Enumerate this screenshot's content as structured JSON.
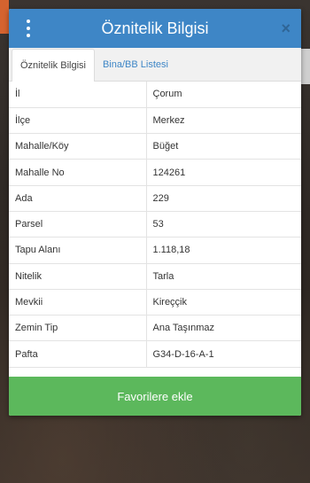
{
  "modal": {
    "title": "Öznitelik Bilgisi",
    "close_symbol": "×",
    "menu_icon": "vertical-dots-icon"
  },
  "tabs": [
    {
      "label": "Öznitelik Bilgisi",
      "active": true
    },
    {
      "label": "Bina/BB Listesi",
      "active": false
    }
  ],
  "attributes": [
    {
      "key": "İl",
      "value": "Çorum"
    },
    {
      "key": "İlçe",
      "value": "Merkez"
    },
    {
      "key": "Mahalle/Köy",
      "value": "Büğet"
    },
    {
      "key": "Mahalle No",
      "value": "124261"
    },
    {
      "key": "Ada",
      "value": "229"
    },
    {
      "key": "Parsel",
      "value": "53"
    },
    {
      "key": "Tapu Alanı",
      "value": "1.118,18"
    },
    {
      "key": "Nitelik",
      "value": "Tarla"
    },
    {
      "key": "Mevkii",
      "value": "Kireççik"
    },
    {
      "key": "Zemin Tip",
      "value": "Ana Taşınmaz"
    },
    {
      "key": "Pafta",
      "value": "G34-D-16-A-1"
    }
  ],
  "footer": {
    "favorite_label": "Favorilere ekle"
  },
  "colors": {
    "header": "#3e86c6",
    "favorite_button": "#5cb85c",
    "tab_link": "#3e86c6"
  }
}
